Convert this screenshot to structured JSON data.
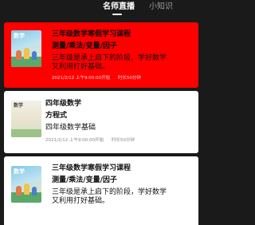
{
  "tabs": [
    {
      "label": "名师直播",
      "active": true
    },
    {
      "label": "小知识",
      "active": false
    }
  ],
  "courses": [
    {
      "cover_title": "数学",
      "title": "三年级数学寒假学习课程",
      "subtitle": "测量/乘法/变量/因子",
      "description": "三年级是承上启下的阶段，学好数学又利用打好基础。",
      "time": "2021/2/12 上午9:00:00开始",
      "duration": "时长50分钟",
      "highlight": true
    },
    {
      "cover_title": "数学",
      "title": "四年级数学",
      "subtitle": "方程式",
      "description": "四年级数学基础",
      "time": "2021/2/12 上午9:00:00开始",
      "duration": "时长50分钟",
      "highlight": false
    },
    {
      "cover_title": "数学",
      "title": "三年级数学寒假学习课程",
      "subtitle": "测量/乘法/变量/因子",
      "description": "三年级是承上启下的阶段，学好数学又利用打好基础。",
      "highlight": false
    }
  ],
  "colors": {
    "highlight": "#ff0000",
    "background": "#1a1a1a"
  }
}
